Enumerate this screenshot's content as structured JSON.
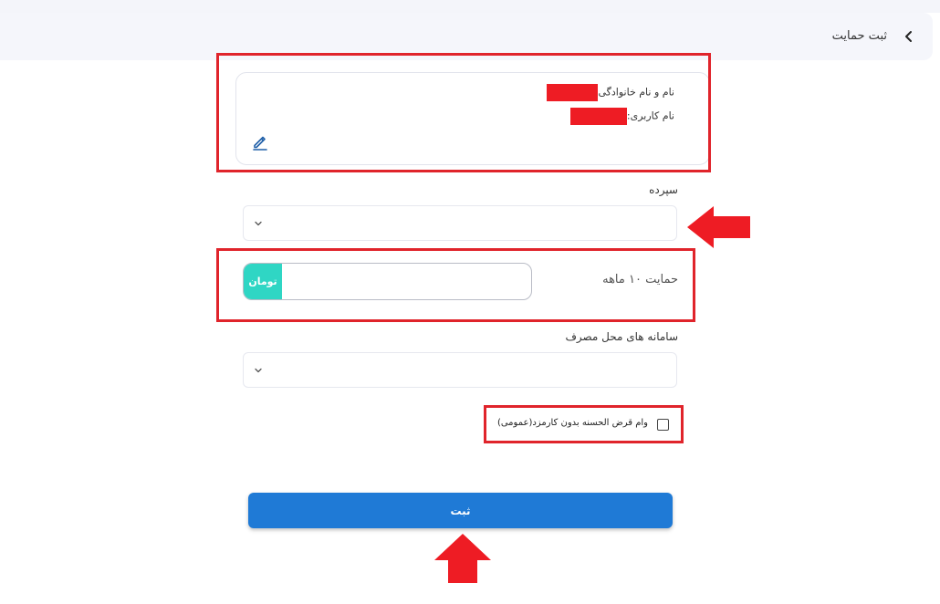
{
  "header": {
    "title": "ثبت حمایت"
  },
  "user_card": {
    "full_name_label": "نام و نام خانوادگی",
    "username_label": "نام کاربری:"
  },
  "deposit": {
    "label": "سپرده",
    "selected_value": ""
  },
  "support": {
    "label": "حمایت ۱۰ ماهه",
    "unit": "تومان",
    "value": ""
  },
  "usage_system": {
    "label": "سامانه های محل مصرف",
    "selected_value": ""
  },
  "loan_option": {
    "label": "وام قرض الحسنه بدون کارمزد(عمومی)",
    "checked": false
  },
  "submit": {
    "label": "ثبت"
  },
  "colors": {
    "primary": "#1f7ad6",
    "unit_badge": "#2fd6c4",
    "annotation": "#e0242b",
    "redaction": "#ee1c24"
  }
}
